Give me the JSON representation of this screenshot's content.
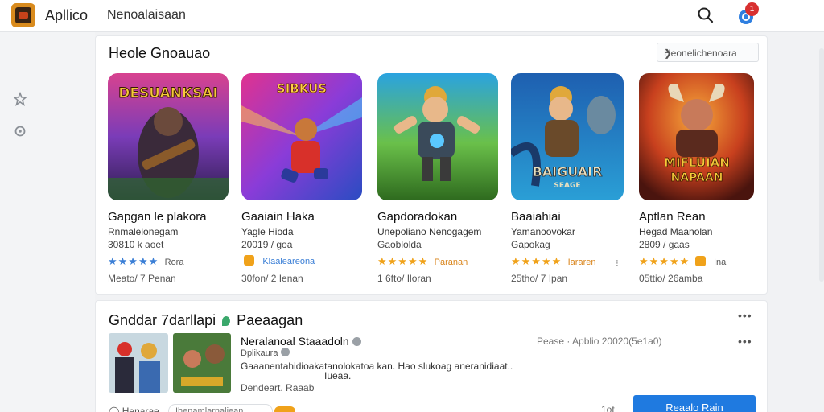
{
  "header": {
    "app_name": "Apllico",
    "nav_title": "Nenoalaisaan",
    "notification_count": "1",
    "search_icon": "search-icon",
    "bell_icon": "bell-icon"
  },
  "sidebar": {
    "items": [
      {
        "icon": "star-icon"
      },
      {
        "icon": "settings-icon"
      }
    ]
  },
  "featured": {
    "title": "Heole Gnoauao",
    "sort_label": "Heonelichenoara",
    "games": [
      {
        "title": "Gapgan le plakora",
        "subtitle": "Rnmalelonegam",
        "meta": "30810 k aoet",
        "stars": "★★★★★",
        "star_style": "blue",
        "rating_label": "Rora",
        "price": "Meato/ 7 Penan",
        "art": {
          "title_art": "DESUANKSAI",
          "bg_top": "#d8428f",
          "bg_bottom": "#3e1e6e"
        }
      },
      {
        "title": "Gaaiain Haka",
        "subtitle": "Yagle Hioda",
        "meta": "20019 / goa",
        "stars": "★★★★★",
        "star_style": "chip",
        "rating_label": "Klaaleareona",
        "price": "30fon/ 2 Ienan",
        "art": {
          "title_art": "SIBKUS",
          "bg_top": "#e0328f",
          "bg_bottom": "#2a4cc2"
        }
      },
      {
        "title": "Gapdoradokan",
        "subtitle": "Unepoliano Nenogagem",
        "meta": "Gaoblolda",
        "stars": "★★★★★",
        "star_style": "orange",
        "rating_label": "Paranan",
        "price": "1 6fto/ Iloran",
        "art": {
          "title_art": "",
          "bg_top": "#2aa3e0",
          "bg_bottom": "#3b8a2a"
        }
      },
      {
        "title": "Baaiahiai",
        "subtitle": "Yamanoovokar",
        "meta": "Gapokag",
        "stars": "★★★★★",
        "star_style": "chip",
        "rating_label": "Iararen",
        "price": "25tho/ 7 Ipan",
        "art": {
          "title_art": "BAIGUAIR",
          "title_sub": "SEAGE",
          "bg_top": "#1e5fb0",
          "bg_bottom": "#2a9fd6"
        }
      },
      {
        "title": "Aptlan Rean",
        "subtitle": "Hegad Maanolan",
        "meta": "2809 / gaas",
        "stars": "★★★★★",
        "star_style": "chip",
        "rating_label": "Ina",
        "price": "05ttio/ 26amba",
        "art": {
          "title_art": "MIFLUIAN",
          "title_sub": "NAPAAN",
          "bg_top": "#e8801e",
          "bg_bottom": "#6e1e14"
        }
      }
    ]
  },
  "news": {
    "title_a": "Gnddar 7darllapi",
    "title_b": "Paeaagan",
    "item": {
      "title": "Neralanoal Staaadoln",
      "author": "Dplikaura",
      "date": "Pease · Apblio 20020(5e1a0)",
      "body": "Gaaanentahidioakatanolokatoa kan. Hao slukoag aneranidiaat..",
      "body_tail": "Iueaa.",
      "link": "Dendeart. Raaab"
    },
    "footer_label": "Henarae",
    "tag_placeholder": "Ihenamlarnaliean",
    "count": "1ot",
    "cta_label": "Reaalo Rain"
  },
  "colors": {
    "accent": "#1f7ae0",
    "badge": "#d83030",
    "star": "#f0a21a",
    "star_blue": "#3b7fd6"
  }
}
